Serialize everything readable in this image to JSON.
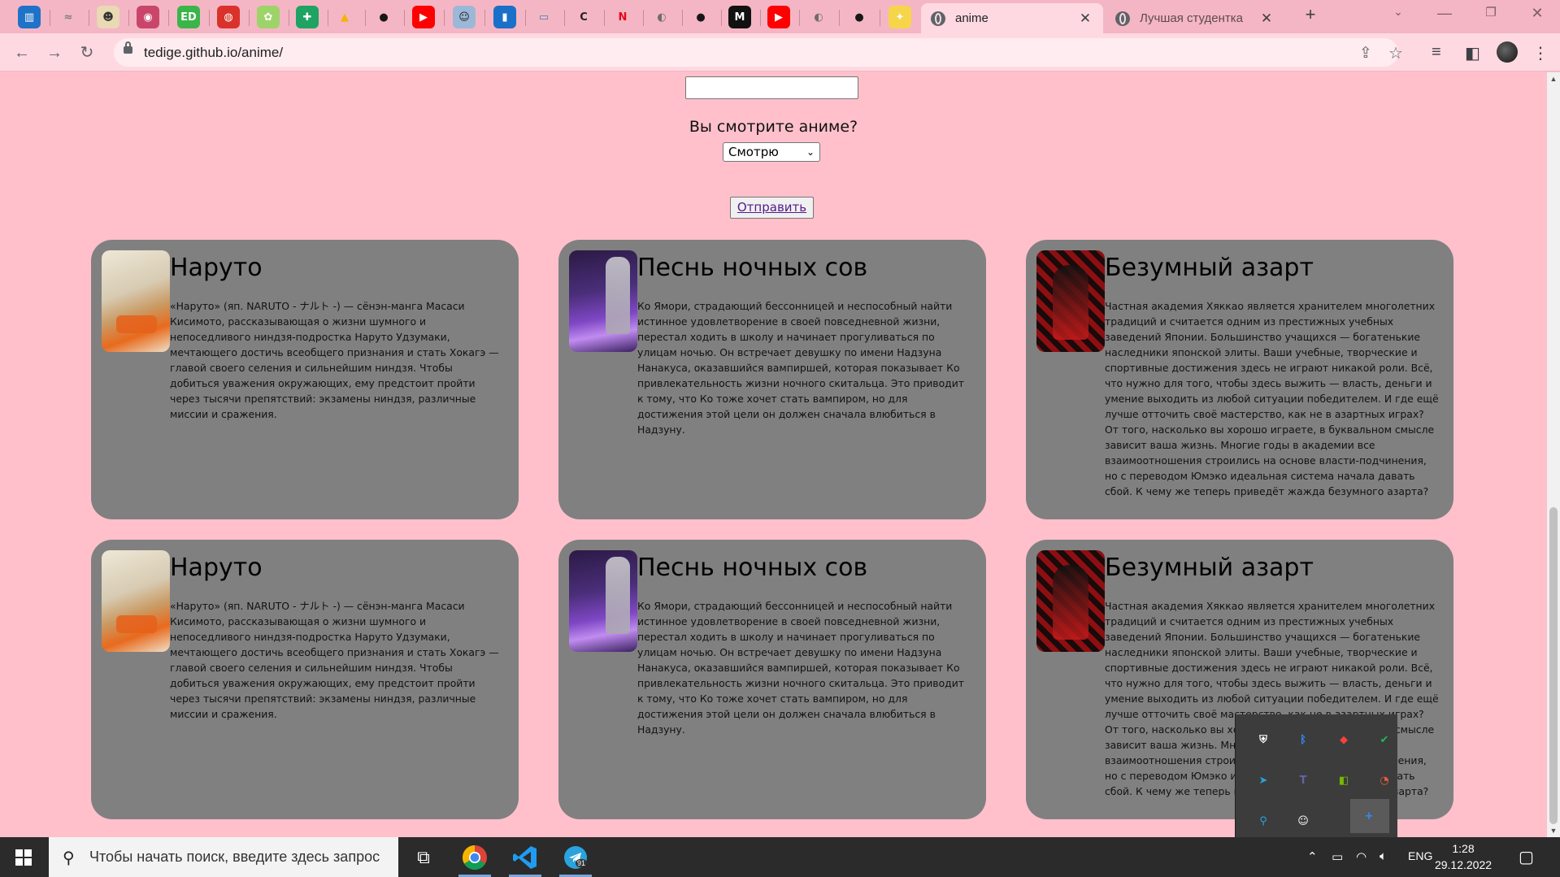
{
  "browser": {
    "pinned_tabs": [
      {
        "icon": "trello-icon",
        "glyph": "▥",
        "bg": "#1f72c8",
        "fg": "#ffffff"
      },
      {
        "icon": "notes-icon",
        "glyph": "≈",
        "bg": "transparent",
        "fg": "#7d7d7d"
      },
      {
        "icon": "anime-face-icon",
        "glyph": "☻",
        "bg": "#e9d9b5",
        "fg": "#333333"
      },
      {
        "icon": "shikimori-icon",
        "glyph": "◉",
        "bg": "#c9466a",
        "fg": "#ffffff"
      },
      {
        "icon": "ed-icon",
        "glyph": "ED",
        "bg": "#3bb54a",
        "fg": "#ffffff"
      },
      {
        "icon": "adblock-icon",
        "glyph": "◍",
        "bg": "#d9322a",
        "fg": "#ffffff"
      },
      {
        "icon": "cartoon-icon",
        "glyph": "✿",
        "bg": "#9ed36a",
        "fg": "#ffffff"
      },
      {
        "icon": "sheets-icon",
        "glyph": "✚",
        "bg": "#1ea362",
        "fg": "#ffffff"
      },
      {
        "icon": "drive-icon",
        "glyph": "▲",
        "bg": "transparent",
        "fg": "#f4b400"
      },
      {
        "icon": "github-icon",
        "glyph": "●",
        "bg": "transparent",
        "fg": "#181717"
      },
      {
        "icon": "youtube-icon",
        "glyph": "▶",
        "bg": "#ff0000",
        "fg": "#ffffff"
      },
      {
        "icon": "manga-icon",
        "glyph": "☺",
        "bg": "#9bb8d8",
        "fg": "#222222"
      },
      {
        "icon": "book-icon",
        "glyph": "▮",
        "bg": "#1a6fc9",
        "fg": "#ffffff"
      },
      {
        "icon": "open-book-icon",
        "glyph": "▭",
        "bg": "transparent",
        "fg": "#4a7bb5"
      },
      {
        "icon": "code-icon",
        "glyph": "C",
        "bg": "transparent",
        "fg": "#222222"
      },
      {
        "icon": "netflix-icon",
        "glyph": "N",
        "bg": "transparent",
        "fg": "#e50914"
      },
      {
        "icon": "globe-icon",
        "glyph": "◐",
        "bg": "transparent",
        "fg": "#6d6d6d"
      },
      {
        "icon": "github-icon",
        "glyph": "●",
        "bg": "transparent",
        "fg": "#181717"
      },
      {
        "icon": "medium-icon",
        "glyph": "M",
        "bg": "#111111",
        "fg": "#ffffff"
      },
      {
        "icon": "youtube-icon",
        "glyph": "▶",
        "bg": "#ff0000",
        "fg": "#ffffff"
      },
      {
        "icon": "globe-icon",
        "glyph": "◐",
        "bg": "transparent",
        "fg": "#6d6d6d"
      },
      {
        "icon": "github-icon",
        "glyph": "●",
        "bg": "transparent",
        "fg": "#181717"
      },
      {
        "icon": "star-badge-icon",
        "glyph": "✦",
        "bg": "#f6d54a",
        "fg": "#ffffff"
      }
    ],
    "tabs": [
      {
        "title": "anime",
        "active": true
      },
      {
        "title": "Лучшая студентка",
        "active": false
      }
    ],
    "new_tab_symbol": "+",
    "url": "tedige.github.io/anime/"
  },
  "form": {
    "name_value": "",
    "question": "Вы смотрите аниме?",
    "select_value": "Смотрю",
    "submit_label": "Отправить"
  },
  "cards": [
    {
      "poster": "naruto",
      "title": "Наруто",
      "description": "«Наруто» (яп. NARUTO - ナルト -) — сёнэн-манга Масаси Кисимото, рассказывающая о жизни шумного и непоседливого ниндзя-подростка Наруто Удзумаки, мечтающего достичь всеобщего признания и стать Хокагэ — главой своего селения и сильнейшим ниндзя. Чтобы добиться уважения окружающих, ему предстоит пройти через тысячи препятствий: экзамены ниндзя, различные миссии и сражения."
    },
    {
      "poster": "owl",
      "title": "Песнь ночных сов",
      "description": "Ко Ямори, страдающий бессонницей и неспособный найти истинное удовлетворение в своей повседневной жизни, перестал ходить в школу и начинает прогуливаться по улицам ночью. Он встречает девушку по имени Надзуна Нанакуса, оказавшийся вампиршей, которая показывает Ко привлекательность жизни ночного скитальца. Это приводит к тому, что Ко тоже хочет стать вампиром, но для достижения этой цели он должен сначала влюбиться в Надзуну."
    },
    {
      "poster": "kakegurui",
      "title": "Безумный азарт",
      "description": "Частная академия Хяккао является хранителем многолетних традиций и считается одним из престижных учебных заведений Японии. Большинство учащихся — богатенькие наследники японской элиты. Ваши учебные, творческие и спортивные достижения здесь не играют никакой роли. Всё, что нужно для того, чтобы здесь выжить — власть, деньги и умение выходить из любой ситуации победителем. И где ещё лучше отточить своё мастерство, как не в азартных играх? От того, насколько вы хорошо играете, в буквальном смысле зависит ваша жизнь. Многие годы в академии все взаимоотношения строились на основе власти-подчинения, но с переводом Юмэко идеальная система начала давать сбой. К чему же теперь приведёт жажда безумного азарта?"
    },
    {
      "poster": "naruto",
      "title": "Наруто",
      "description": "«Наруто» (яп. NARUTO - ナルト -) — сёнэн-манга Масаси Кисимото, рассказывающая о жизни шумного и непоседливого ниндзя-подростка Наруто Удзумаки, мечтающего достичь всеобщего признания и стать Хокагэ — главой своего селения и сильнейшим ниндзя. Чтобы добиться уважения окружающих, ему предстоит пройти через тысячи препятствий: экзамены ниндзя, различные миссии и сражения."
    },
    {
      "poster": "owl",
      "title": "Песнь ночных сов",
      "description": "Ко Ямори, страдающий бессонницей и неспособный найти истинное удовлетворение в своей повседневной жизни, перестал ходить в школу и начинает прогуливаться по улицам ночью. Он встречает девушку по имени Надзуна Нанакуса, оказавшийся вампиршей, которая показывает Ко привлекательность жизни ночного скитальца. Это приводит к тому, что Ко тоже хочет стать вампиром, но для достижения этой цели он должен сначала влюбиться в Надзуну."
    },
    {
      "poster": "kakegurui",
      "title": "Безумный азарт",
      "description": "Частная академия Хяккао является хранителем многолетних традиций и считается одним из престижных учебных заведений Японии. Большинство учащихся — богатенькие наследники японской элиты. Ваши учебные, творческие и спортивные достижения здесь не играют никакой роли. Всё, что нужно для того, чтобы здесь выжить — власть, деньги и умение выходить из любой ситуации победителем. И где ещё лучше отточить своё мастерство, как не в азартных играх? От того, насколько вы хорошо играете, в буквальном смысле зависит ваша жизнь. Многие годы в академии все взаимоотношения строились на основе власти-подчинения, но с переводом Юмэко идеальная система начала давать сбой. К чему же теперь приведёт жажда безумного азарта?"
    }
  ],
  "tray_popup": [
    {
      "icon": "security-shield-icon",
      "glyph": "⛨",
      "color": "#ffffff"
    },
    {
      "icon": "bluetooth-icon",
      "glyph": "ᛒ",
      "color": "#2f8cff"
    },
    {
      "icon": "anydesk-icon",
      "glyph": "◆",
      "color": "#ef443b"
    },
    {
      "icon": "defender-check-icon",
      "glyph": "✔",
      "color": "#1db954"
    },
    {
      "icon": "telegram-icon",
      "glyph": "➤",
      "color": "#2aa3de"
    },
    {
      "icon": "teams-icon",
      "glyph": "T",
      "color": "#6264a7"
    },
    {
      "icon": "nvidia-icon",
      "glyph": "◧",
      "color": "#76b900"
    },
    {
      "icon": "vpn-icon",
      "glyph": "◔",
      "color": "#e85d3b"
    },
    {
      "icon": "location-pin-icon",
      "glyph": "⚲",
      "color": "#2aa3de"
    },
    {
      "icon": "discord-icon",
      "glyph": "☺",
      "color": "#ffffff"
    },
    {
      "icon": "add-icon",
      "glyph": "+",
      "color": "#2f8cff"
    }
  ],
  "taskbar": {
    "search_placeholder": "Чтобы начать поиск, введите здесь запрос",
    "telegram_badge": "91",
    "language": "ENG",
    "time": "1:28",
    "date": "29.12.2022"
  }
}
